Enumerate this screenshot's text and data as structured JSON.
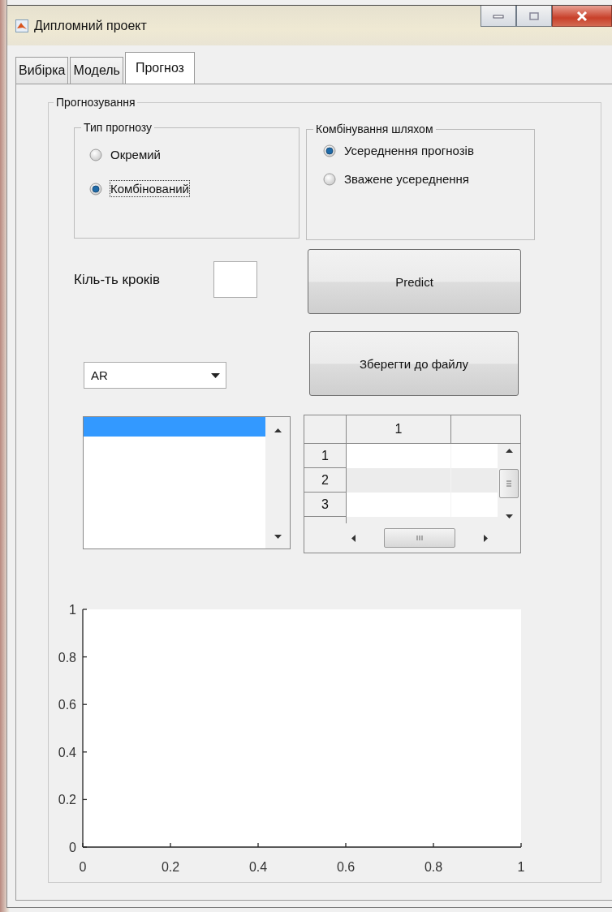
{
  "window": {
    "title": "Дипломний проект"
  },
  "tabs": [
    {
      "label": "Вибірка",
      "selected": false
    },
    {
      "label": "Модель",
      "selected": false
    },
    {
      "label": "Прогноз",
      "selected": true
    }
  ],
  "panel": {
    "title": "Прогнозування",
    "forecast_type": {
      "title": "Тип прогнозу",
      "options": [
        {
          "label": "Окремий",
          "selected": false,
          "focused": false
        },
        {
          "label": "Комбінований",
          "selected": true,
          "focused": true
        }
      ]
    },
    "combination": {
      "title": "Комбінування шляхом",
      "options": [
        {
          "label": "Усереднення прогнозів",
          "selected": true,
          "focused": false
        },
        {
          "label": "Зважене усереднення",
          "selected": false,
          "focused": false
        }
      ]
    },
    "steps": {
      "label": "Кіль-ть кроків"
    },
    "buttons": [
      {
        "label": "Predict"
      },
      {
        "label": "Зберегти до файлу"
      }
    ],
    "model_select": {
      "value": "AR"
    },
    "listbox": {
      "rows": [
        {
          "selected": true
        }
      ]
    },
    "table": {
      "columns": [
        "1"
      ],
      "rows": [
        "1",
        "2",
        "3"
      ]
    },
    "chart": {
      "chart_data": {
        "type": "line",
        "xlim": [
          0,
          1
        ],
        "ylim": [
          0,
          1
        ],
        "xticks": [
          0,
          0.2,
          0.4,
          0.6,
          0.8,
          1
        ],
        "yticks": [
          0,
          0.2,
          0.4,
          0.6,
          0.8,
          1
        ]
      }
    }
  }
}
